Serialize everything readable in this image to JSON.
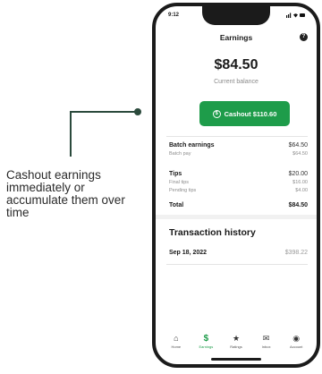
{
  "caption": "Cashout earnings immediately or accumulate them over time",
  "status": {
    "time": "9:12",
    "icons": "..ıl ᯤ ▬"
  },
  "screen": {
    "title": "Earnings",
    "help_icon": "question-icon"
  },
  "balance": {
    "amount": "$84.50",
    "label": "Current balance"
  },
  "cashout": {
    "label": "Cashout $110.60",
    "icon": "dollar-circle-icon"
  },
  "batch": {
    "label": "Batch earnings",
    "value": "$64.50",
    "sub_label": "Batch pay",
    "sub_value": "$64.50"
  },
  "tips": {
    "label": "Tips",
    "value": "$20.00",
    "final_label": "Final tips",
    "final_value": "$16.00",
    "pending_label": "Pending tips",
    "pending_value": "$4.00"
  },
  "total": {
    "label": "Total",
    "value": "$84.50"
  },
  "history": {
    "title": "Transaction history",
    "rows": [
      {
        "date": "Sep 18, 2022",
        "amount": "$398.22"
      }
    ]
  },
  "tabs": [
    {
      "label": "Home",
      "icon": "home-icon",
      "glyph": "⌂",
      "active": false
    },
    {
      "label": "Earnings",
      "icon": "dollar-icon",
      "glyph": "$",
      "active": true
    },
    {
      "label": "Ratings",
      "icon": "star-icon",
      "glyph": "★",
      "active": false
    },
    {
      "label": "Inbox",
      "icon": "inbox-icon",
      "glyph": "✉",
      "active": false
    },
    {
      "label": "Account",
      "icon": "account-icon",
      "glyph": "◉",
      "active": false
    }
  ],
  "colors": {
    "accent": "#1e9c4a",
    "callout": "#2b4a3c"
  }
}
